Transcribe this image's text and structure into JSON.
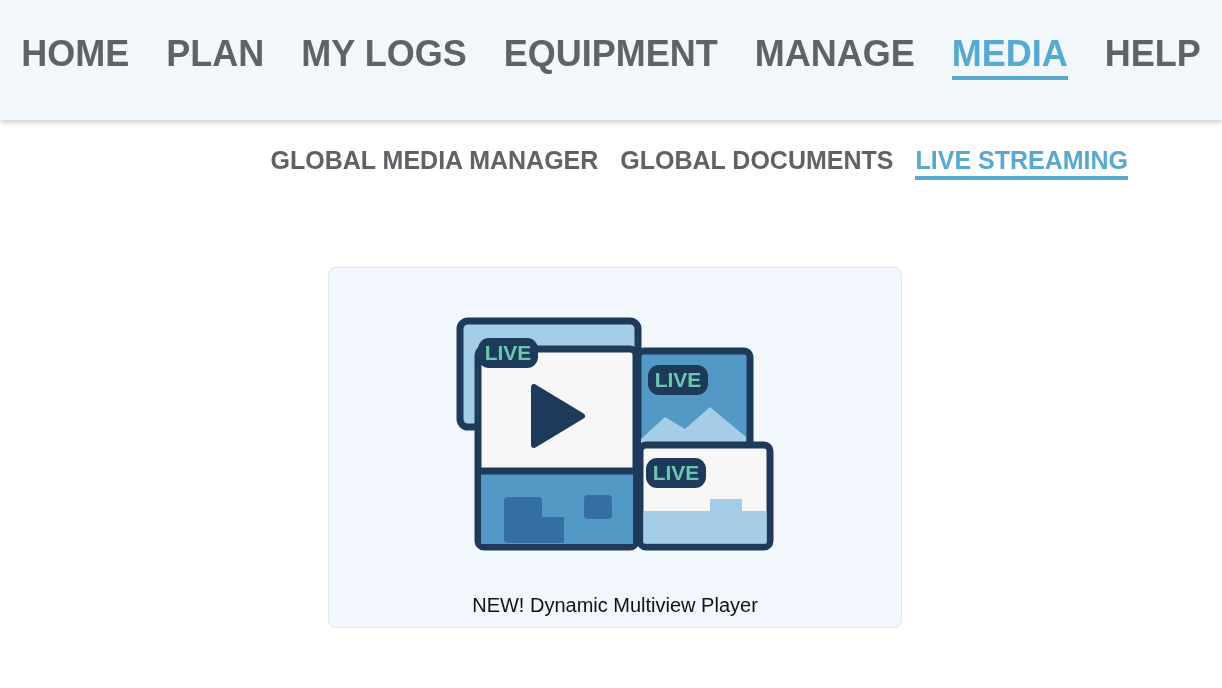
{
  "nav": {
    "items": [
      {
        "label": "HOME",
        "selected": false
      },
      {
        "label": "PLAN",
        "selected": false
      },
      {
        "label": "MY LOGS",
        "selected": false
      },
      {
        "label": "EQUIPMENT",
        "selected": false
      },
      {
        "label": "MANAGE",
        "selected": false
      },
      {
        "label": "MEDIA",
        "selected": true
      },
      {
        "label": "HELP",
        "selected": false
      }
    ]
  },
  "subnav": {
    "items": [
      {
        "label": "GLOBAL MEDIA MANAGER",
        "selected": false
      },
      {
        "label": "GLOBAL DOCUMENTS",
        "selected": false
      },
      {
        "label": "LIVE STREAMING",
        "selected": true
      }
    ]
  },
  "card": {
    "badges": [
      "LIVE",
      "LIVE",
      "LIVE"
    ],
    "caption": "NEW! Dynamic Multiview Player"
  }
}
